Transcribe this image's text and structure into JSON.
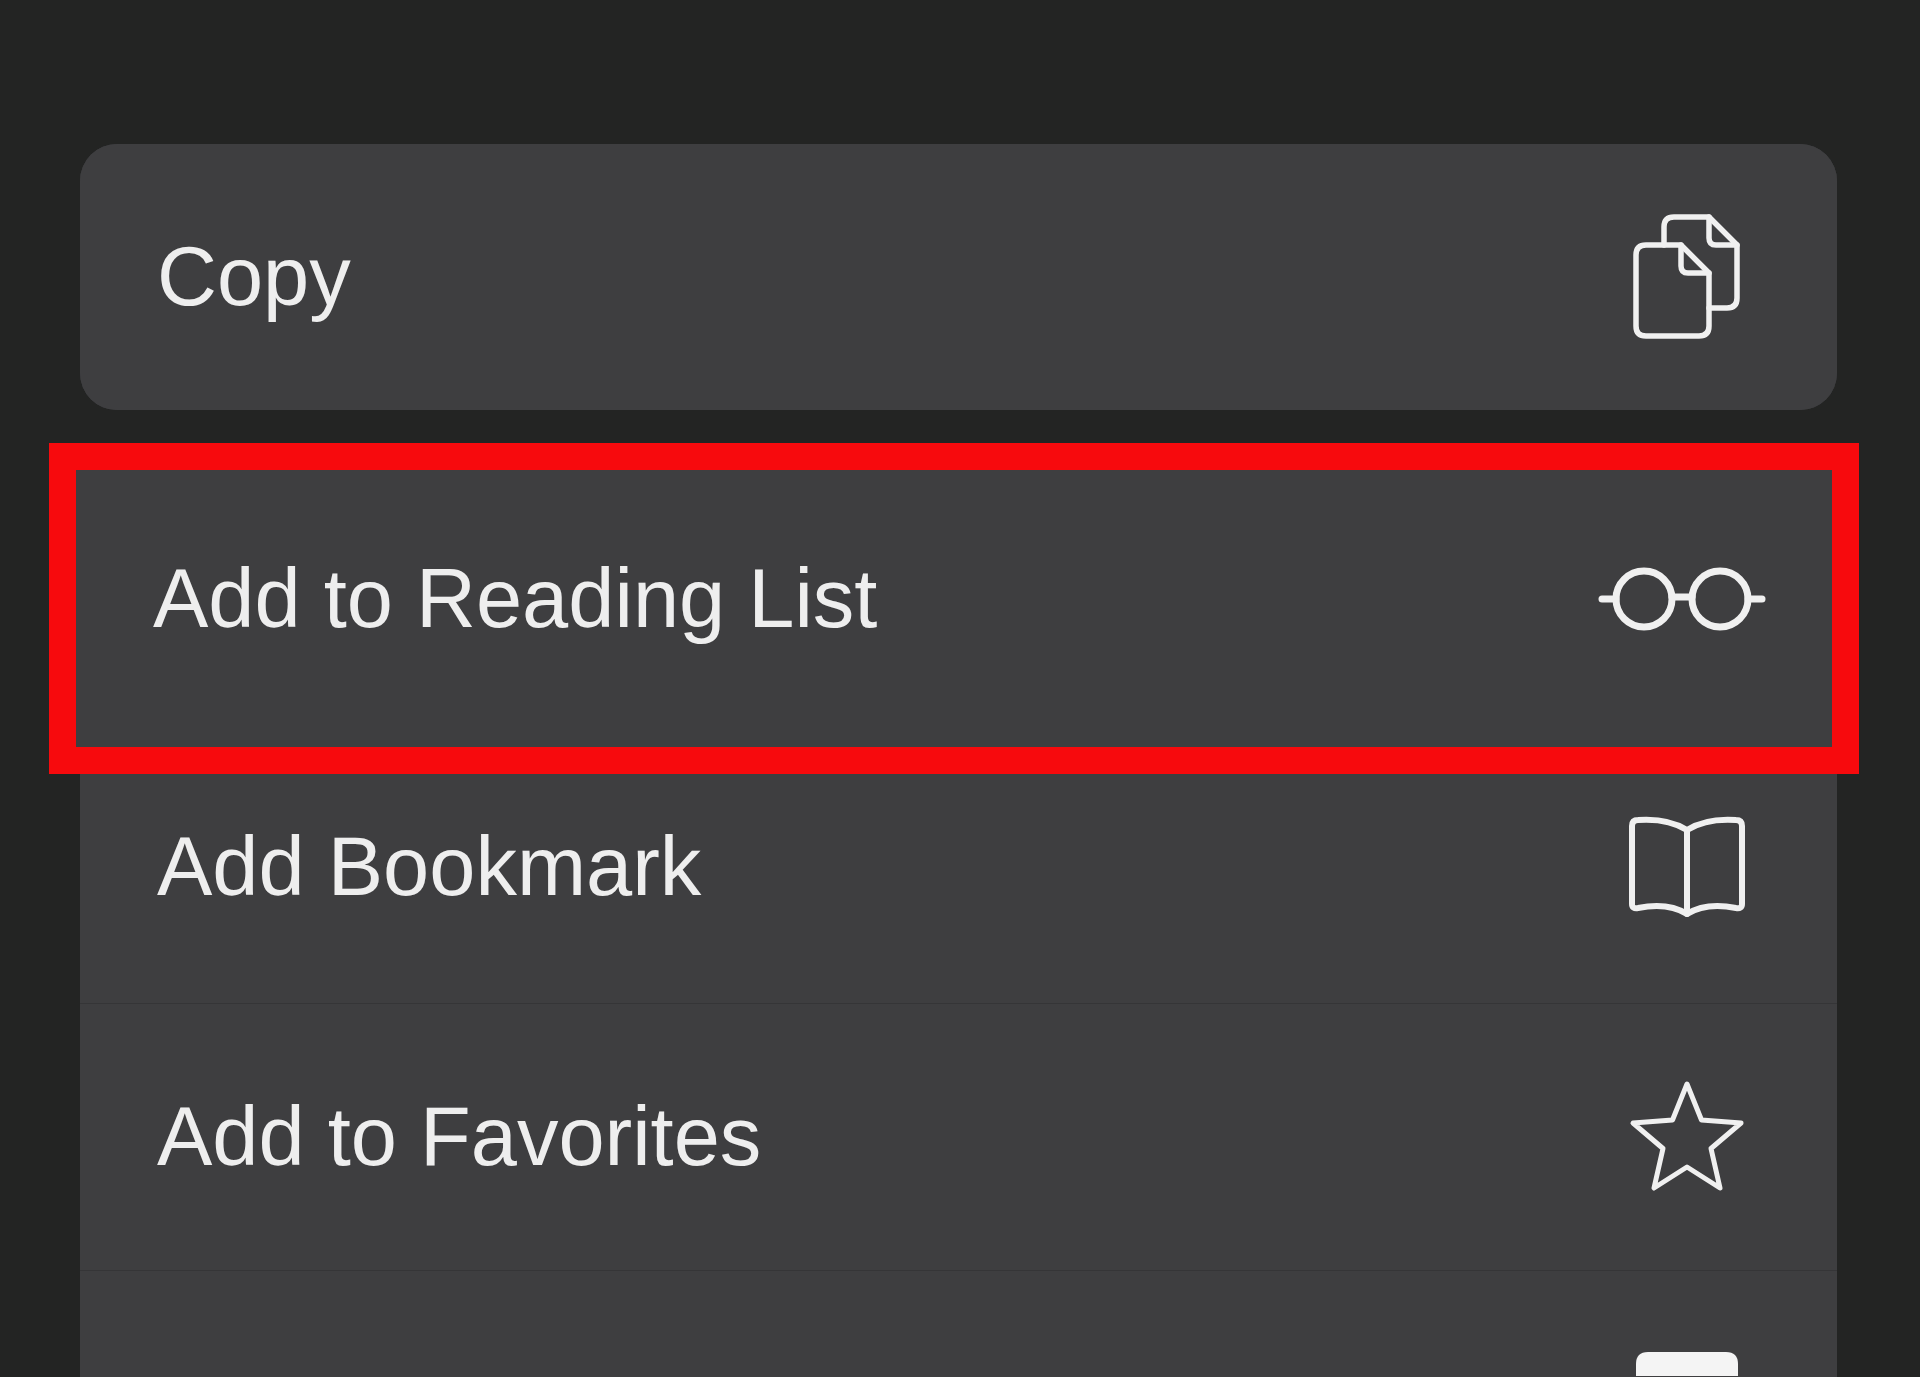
{
  "menu": {
    "groups": [
      {
        "items": [
          {
            "label": "Copy",
            "highlighted": false
          }
        ]
      },
      {
        "items": [
          {
            "label": "Add to Reading List",
            "highlighted": true
          },
          {
            "label": "Add Bookmark",
            "highlighted": false
          },
          {
            "label": "Add to Favorites",
            "highlighted": false
          },
          {
            "highlighted": false
          }
        ]
      }
    ]
  }
}
